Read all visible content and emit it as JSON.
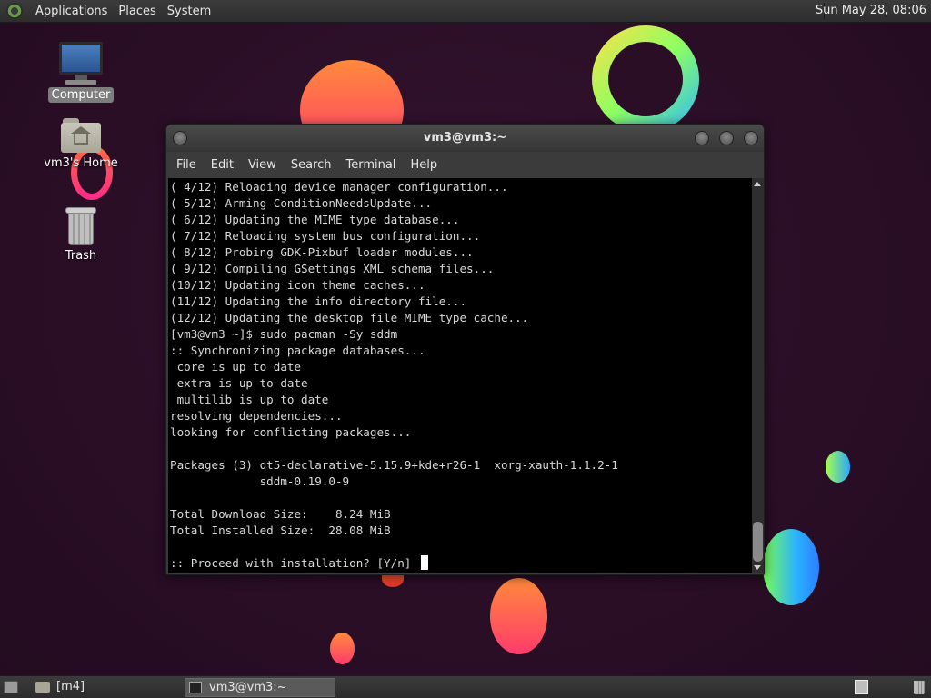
{
  "top_panel": {
    "menus": [
      "Applications",
      "Places",
      "System"
    ],
    "clock": "Sun May 28, 08:06"
  },
  "desktop": {
    "icons": [
      {
        "label": "Computer",
        "icon": "computer-icon",
        "selected": true
      },
      {
        "label": "vm3's Home",
        "icon": "home-folder-icon",
        "selected": false
      },
      {
        "label": "Trash",
        "icon": "trash-icon",
        "selected": false
      }
    ]
  },
  "window": {
    "title": "vm3@vm3:~",
    "menu": [
      "File",
      "Edit",
      "View",
      "Search",
      "Terminal",
      "Help"
    ],
    "terminal_lines": [
      "( 4/12) Reloading device manager configuration...",
      "( 5/12) Arming ConditionNeedsUpdate...",
      "( 6/12) Updating the MIME type database...",
      "( 7/12) Reloading system bus configuration...",
      "( 8/12) Probing GDK-Pixbuf loader modules...",
      "( 9/12) Compiling GSettings XML schema files...",
      "(10/12) Updating icon theme caches...",
      "(11/12) Updating the info directory file...",
      "(12/12) Updating the desktop file MIME type cache...",
      "[vm3@vm3 ~]$ sudo pacman -Sy sddm",
      ":: Synchronizing package databases...",
      " core is up to date",
      " extra is up to date",
      " multilib is up to date",
      "resolving dependencies...",
      "looking for conflicting packages...",
      "",
      "Packages (3) qt5-declarative-5.15.9+kde+r26-1  xorg-xauth-1.1.2-1",
      "             sddm-0.19.0-9",
      "",
      "Total Download Size:    8.24 MiB",
      "Total Installed Size:  28.08 MiB",
      "",
      ":: Proceed with installation? [Y/n] "
    ]
  },
  "bottom_panel": {
    "folder_label": "[m4]",
    "task_label": "vm3@vm3:~"
  }
}
